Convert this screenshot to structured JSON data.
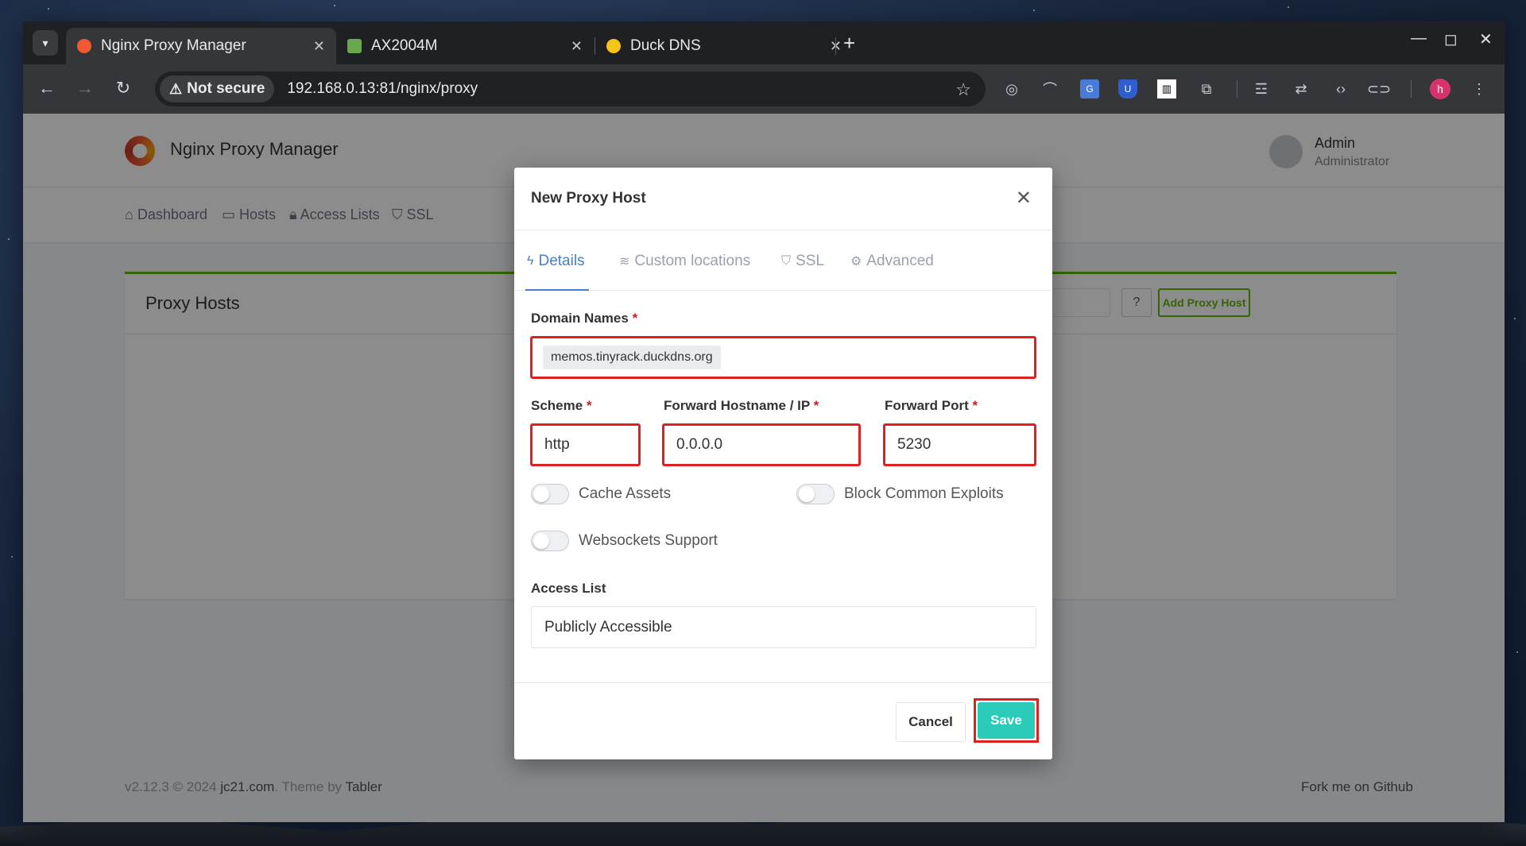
{
  "browser": {
    "tabs": [
      {
        "title": "Nginx Proxy Manager",
        "active": true
      },
      {
        "title": "AX2004M",
        "active": false
      },
      {
        "title": "Duck DNS",
        "active": false
      }
    ],
    "security_label": "Not secure",
    "url": "192.168.0.13:81/nginx/proxy",
    "profile_initial": "h"
  },
  "app": {
    "brand": "Nginx Proxy Manager",
    "user_name": "Admin",
    "user_role": "Administrator",
    "nav": [
      "Dashboard",
      "Hosts",
      "Access Lists",
      "SSL"
    ],
    "card_title": "Proxy Hosts",
    "search_placeholder": "rch Host…",
    "add_button": "Add Proxy Host",
    "footer_version": "v2.12.3 © 2024 ",
    "footer_link": "jc21.com",
    "footer_theme": ". Theme by ",
    "footer_tabler": "Tabler",
    "footer_right": "Fork me on Github"
  },
  "modal": {
    "title": "New Proxy Host",
    "tabs": [
      "Details",
      "Custom locations",
      "SSL",
      "Advanced"
    ],
    "domain_label": "Domain Names",
    "domain_value": "memos.tinyrack.duckdns.org",
    "scheme_label": "Scheme",
    "scheme_value": "http",
    "hostname_label": "Forward Hostname / IP",
    "hostname_value": "0.0.0.0",
    "port_label": "Forward Port",
    "port_value": "5230",
    "required_mark": "*",
    "toggles": {
      "cache_assets": "Cache Assets",
      "block_exploits": "Block Common Exploits",
      "websockets": "Websockets Support"
    },
    "access_list_label": "Access List",
    "access_list_value": "Publicly Accessible",
    "cancel": "Cancel",
    "save": "Save"
  },
  "colors": {
    "accent_blue": "#467fcf",
    "save_teal": "#2bcbba",
    "highlight_red": "#e02020",
    "green": "#5eba00"
  }
}
